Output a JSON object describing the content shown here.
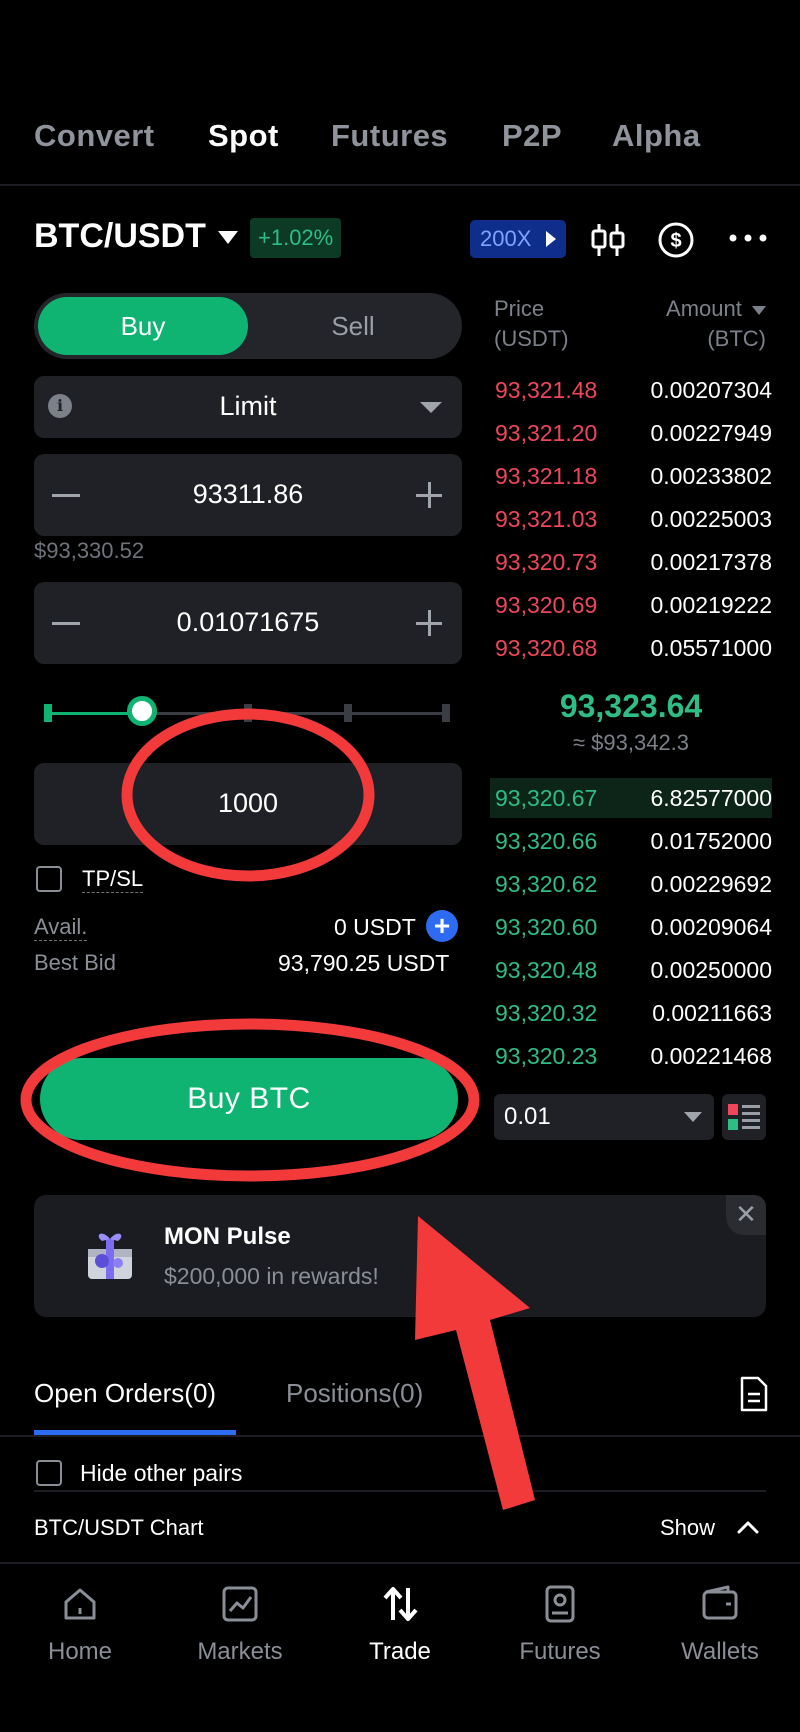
{
  "top_tabs": [
    {
      "label": "Convert",
      "active": false
    },
    {
      "label": "Spot",
      "active": true
    },
    {
      "label": "Futures",
      "active": false
    },
    {
      "label": "P2P",
      "active": false
    },
    {
      "label": "Alpha",
      "active": false
    }
  ],
  "header": {
    "pair": "BTC/USDT",
    "change": "+1.02%",
    "leverage": "200X"
  },
  "order_form": {
    "side_buy": "Buy",
    "side_sell": "Sell",
    "order_type": "Limit",
    "price": "93311.86",
    "price_usd": "$93,330.52",
    "amount": "0.01071675",
    "slider_percent": 25,
    "total": "1000",
    "tpsl_label": "TP/SL",
    "avail_label": "Avail.",
    "avail_value": "0 USDT",
    "best_bid_label": "Best Bid",
    "best_bid_value": "93,790.25 USDT",
    "submit_label": "Buy  BTC"
  },
  "order_book": {
    "price_header_1": "Price",
    "price_header_2": "(USDT)",
    "amount_header_1": "Amount",
    "amount_header_2": "(BTC)",
    "asks": [
      {
        "price": "93,321.48",
        "amount": "0.00207304"
      },
      {
        "price": "93,321.20",
        "amount": "0.00227949"
      },
      {
        "price": "93,321.18",
        "amount": "0.00233802"
      },
      {
        "price": "93,321.03",
        "amount": "0.00225003"
      },
      {
        "price": "93,320.73",
        "amount": "0.00217378"
      },
      {
        "price": "93,320.69",
        "amount": "0.00219222"
      },
      {
        "price": "93,320.68",
        "amount": "0.05571000"
      }
    ],
    "mid_price": "93,323.64",
    "mid_usd": "≈ $93,342.3",
    "bids": [
      {
        "price": "93,320.67",
        "amount": "6.82577000"
      },
      {
        "price": "93,320.66",
        "amount": "0.01752000"
      },
      {
        "price": "93,320.62",
        "amount": "0.00229692"
      },
      {
        "price": "93,320.60",
        "amount": "0.00209064"
      },
      {
        "price": "93,320.48",
        "amount": "0.00250000"
      },
      {
        "price": "93,320.32",
        "amount": "0.00211663"
      },
      {
        "price": "93,320.23",
        "amount": "0.00221468"
      }
    ],
    "decimals": "0.01"
  },
  "promo": {
    "title": "MON Pulse",
    "subtitle": "$200,000 in rewards!"
  },
  "orders": {
    "tab_open": "Open Orders(0)",
    "tab_positions": "Positions(0)",
    "hide_other_pairs": "Hide other pairs",
    "chart_title": "BTC/USDT Chart",
    "chart_toggle": "Show"
  },
  "bottom_nav": [
    {
      "label": "Home",
      "icon": "home-icon",
      "active": false
    },
    {
      "label": "Markets",
      "icon": "markets-icon",
      "active": false
    },
    {
      "label": "Trade",
      "icon": "trade-icon",
      "active": true
    },
    {
      "label": "Futures",
      "icon": "futures-icon",
      "active": false
    },
    {
      "label": "Wallets",
      "icon": "wallet-icon",
      "active": false
    }
  ],
  "colors": {
    "buy_green": "#10b472",
    "ask_red": "#f0465b",
    "bid_green": "#2ebd85",
    "accent_blue": "#2d6bf3",
    "annotation_red": "#f23a3a"
  }
}
